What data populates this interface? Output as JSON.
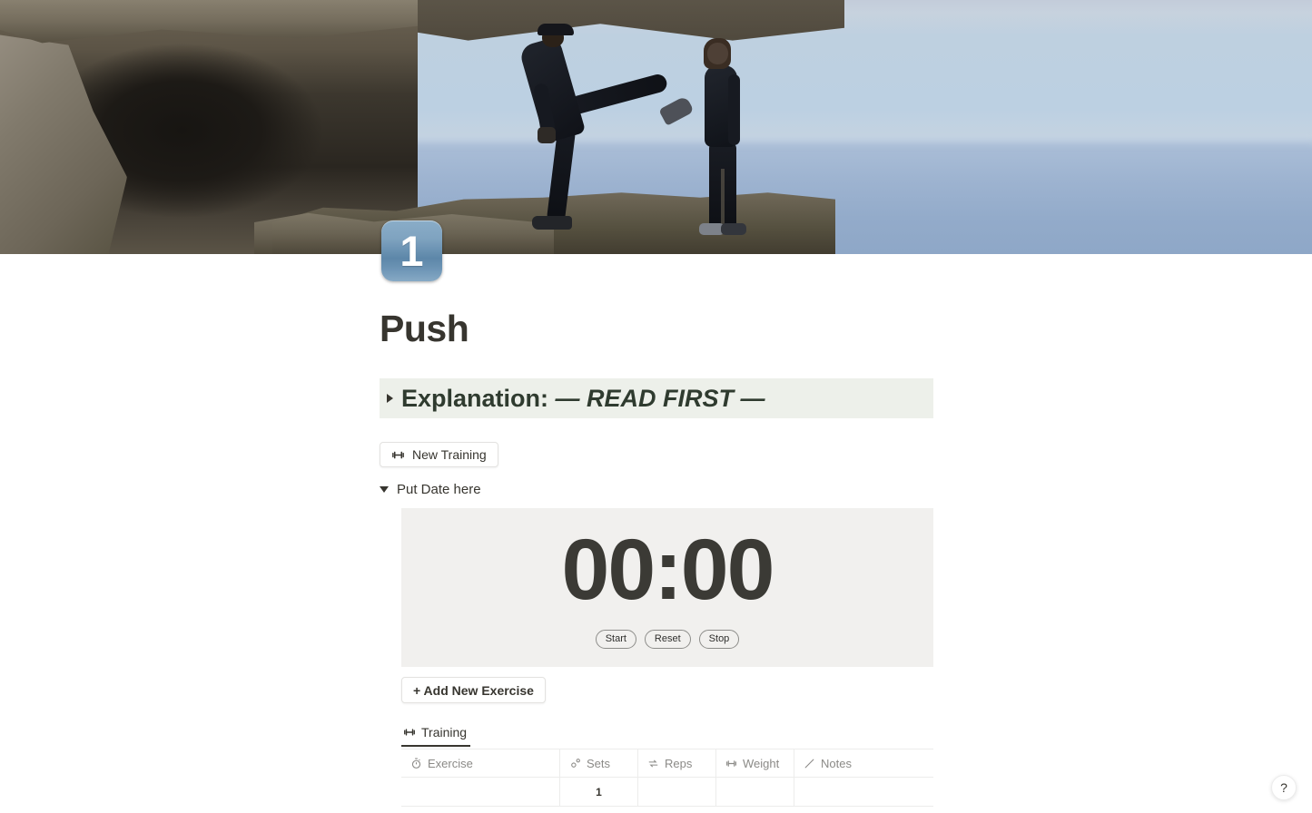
{
  "cover": {
    "alt": "Two people in black athletic wear on a cliff edge above the ocean",
    "icon_label": "1"
  },
  "page": {
    "title": "Push"
  },
  "explanation": {
    "toggle_state": "collapsed",
    "label_plain": "Explanation: ",
    "label_emphasis": "— READ FIRST —",
    "background_color": "#edf0ea"
  },
  "buttons": {
    "new_training": "New Training",
    "add_new_exercise": "+ Add New Exercise"
  },
  "date_toggle": {
    "label": "Put Date here",
    "state": "expanded"
  },
  "timer": {
    "value": "00:00",
    "background_color": "#f1f0ee",
    "controls": [
      {
        "label": "Start"
      },
      {
        "label": "Reset"
      },
      {
        "label": "Stop"
      }
    ]
  },
  "database": {
    "tabs": [
      {
        "label": "Training",
        "icon": "dumbbell-icon",
        "active": true
      }
    ],
    "columns": [
      {
        "label": "Exercise",
        "icon": "stopwatch-icon"
      },
      {
        "label": "Sets",
        "icon": "gear-icon"
      },
      {
        "label": "Reps",
        "icon": "repeat-icon"
      },
      {
        "label": "Weight",
        "icon": "dumbbell-icon"
      },
      {
        "label": "Notes",
        "icon": "pencil-icon"
      }
    ],
    "rows": [
      {
        "exercise": "",
        "sets": "1",
        "reps": "",
        "weight": "",
        "notes": ""
      }
    ]
  },
  "help": {
    "label": "?"
  }
}
